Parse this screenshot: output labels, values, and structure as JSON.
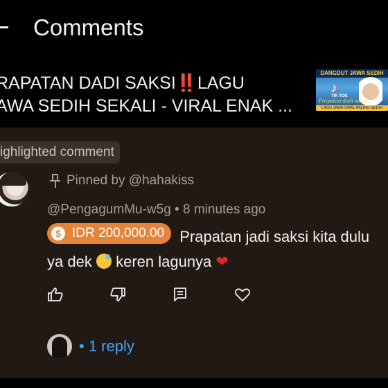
{
  "header": {
    "title": "Comments"
  },
  "video": {
    "title_line1": "RAPATAN DADI SAKSI‼️LAGU",
    "title_line2": "AWA SEDIH SEKALI - VIRAL ENAK ...",
    "thumbnail": {
      "banner": "DANGDUT JAWA SEDIH",
      "logo_label": "TIK TOK",
      "script": "Prapatan dadi saksi",
      "strip": "LAGU JAWA VIRAL PALING SEDIH"
    }
  },
  "comment": {
    "highlight_label": "ighlighted comment",
    "pinned_text": "Pinned by @hahakiss",
    "author": "@PengagumMu-w5g",
    "separator": "•",
    "time": "8 minutes ago",
    "super_thanks_amount": "IDR 200,000.00",
    "text_part1": "Prapatan jadi saksi kita dulu ya dek",
    "text_part2": "keren lagunya",
    "replies_label": "• 1 reply"
  },
  "icons": {
    "back": "back-arrow-icon",
    "pin": "pin-icon",
    "like": "thumbs-up-icon",
    "dislike": "thumbs-down-icon",
    "reply": "reply-icon",
    "heart": "heart-icon",
    "super_thanks": "super-thanks-icon"
  },
  "colors": {
    "background": "#000000",
    "panel": "#211914",
    "accent_link": "#3ea6ff",
    "super_thanks": "#e8843a",
    "muted_text": "#a69e98"
  }
}
